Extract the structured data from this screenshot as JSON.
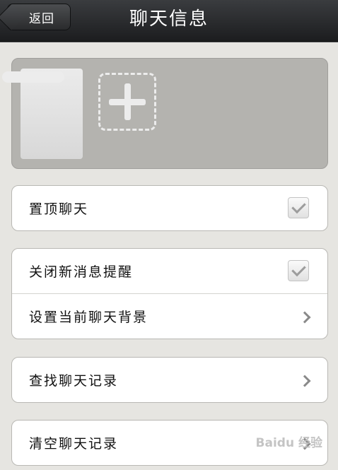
{
  "header": {
    "back_label": "返回",
    "title": "聊天信息"
  },
  "members": {
    "add_icon": "plus-icon"
  },
  "settings": {
    "pin_chat": {
      "label": "置顶聊天",
      "checked": true
    },
    "mute_notifications": {
      "label": "关闭新消息提醒",
      "checked": true
    },
    "chat_background": {
      "label": "设置当前聊天背景"
    },
    "search_history": {
      "label": "查找聊天记录"
    },
    "clear_history": {
      "label": "清空聊天记录"
    }
  },
  "watermark": {
    "text": "Baidu 经验"
  },
  "colors": {
    "background": "#e6e5e1",
    "navbar": "#2b2c2e",
    "card": "#ffffff",
    "members_panel": "#b4b3af"
  }
}
